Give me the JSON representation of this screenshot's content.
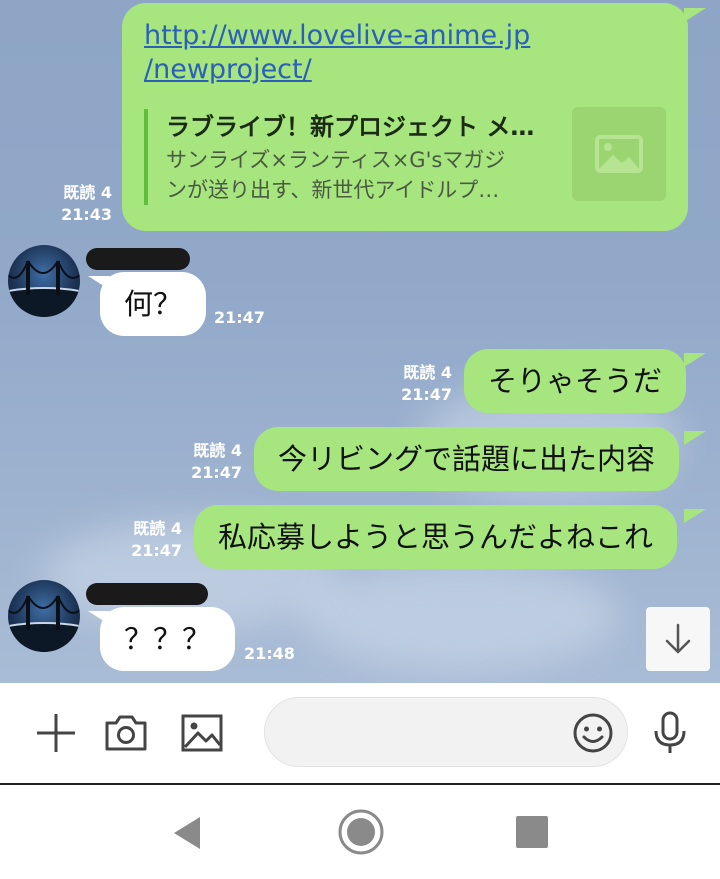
{
  "link_message": {
    "url_line1": "http://www.lovelive-anime.jp",
    "url_line2": "/newproject/",
    "card_title": "ラブライブ！新プロジェクト メ…",
    "card_desc_line1": "サンライズ×ランティス×G'sマガジ",
    "card_desc_line2": "ンが送り出す、新世代アイドルプ…",
    "thumbnail_icon": "image-placeholder-icon",
    "read": "既読 4",
    "time": "21:43"
  },
  "messages": [
    {
      "side": "in",
      "text": "何？",
      "time": "21:47"
    },
    {
      "side": "out",
      "text": "そりゃそうだ",
      "read": "既読 4",
      "time": "21:47"
    },
    {
      "side": "out",
      "text": "今リビングで話題に出た内容",
      "read": "既読 4",
      "time": "21:47"
    },
    {
      "side": "out",
      "text": "私応募しようと思うんだよねこれ",
      "read": "既読 4",
      "time": "21:47"
    },
    {
      "side": "in",
      "text": "？？？",
      "time": "21:48"
    }
  ],
  "toolbar": {
    "icons": [
      "plus-icon",
      "camera-icon",
      "gallery-icon",
      "emoji-icon",
      "microphone-icon"
    ],
    "input_value": ""
  },
  "scroll_button_icon": "arrow-down-icon",
  "navbar_icons": [
    "back-triangle-icon",
    "home-circle-icon",
    "recents-square-icon"
  ],
  "colors": {
    "outgoing_bubble": "#a7e67f",
    "incoming_bubble": "#ffffff",
    "chat_background": "#91a8c9",
    "link": "#2b5fb8"
  }
}
